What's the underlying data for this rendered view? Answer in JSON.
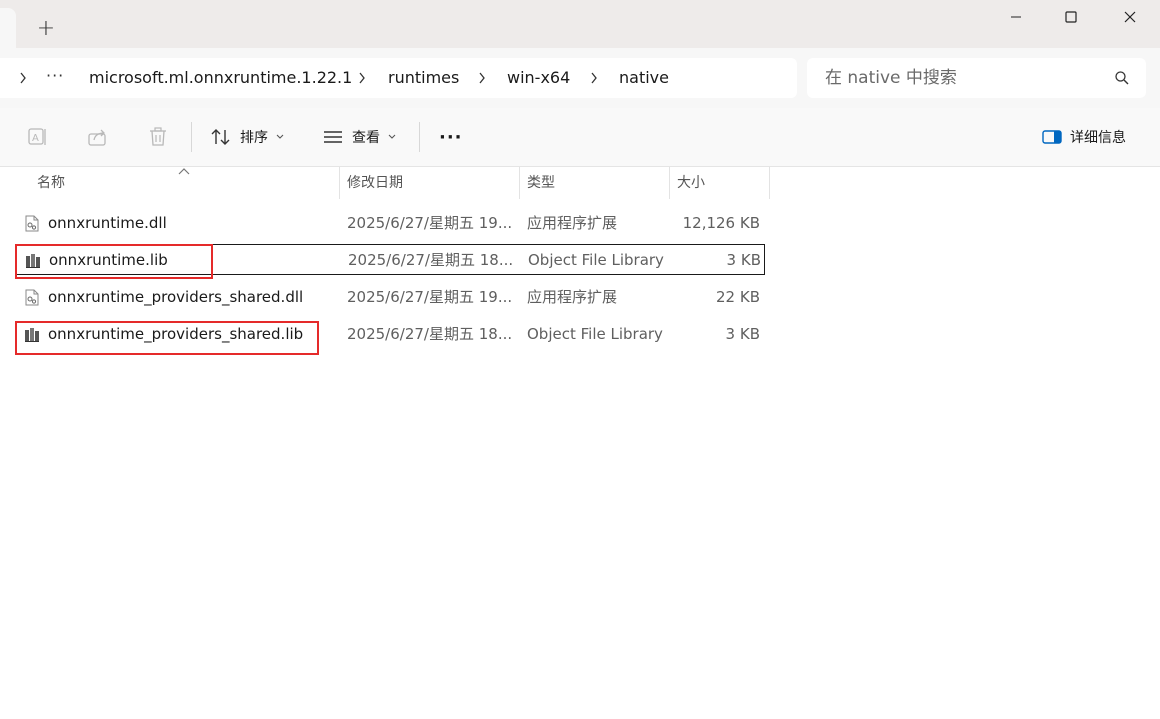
{
  "window": {
    "new_tab_label": "+",
    "controls": {
      "minimize": "minimize",
      "maximize": "maximize",
      "close": "close"
    }
  },
  "address": {
    "overflow": "···",
    "crumbs": [
      "microsoft.ml.onnxruntime.1.22.1",
      "runtimes",
      "win-x64",
      "native"
    ]
  },
  "search": {
    "placeholder": "在 native 中搜索"
  },
  "toolbar": {
    "sort_label": "排序",
    "view_label": "查看",
    "more_label": "···",
    "details_label": "详细信息"
  },
  "columns": {
    "name": "名称",
    "modified": "修改日期",
    "type": "类型",
    "size": "大小"
  },
  "files": [
    {
      "name": "onnxruntime.dll",
      "modified": "2025/6/27/星期五 19...",
      "type": "应用程序扩展",
      "size": "12,126 KB",
      "icon": "dll-file-icon"
    },
    {
      "name": "onnxruntime.lib",
      "modified": "2025/6/27/星期五 18...",
      "type": "Object File Library",
      "size": "3 KB",
      "icon": "lib-file-icon"
    },
    {
      "name": "onnxruntime_providers_shared.dll",
      "modified": "2025/6/27/星期五 19...",
      "type": "应用程序扩展",
      "size": "22 KB",
      "icon": "dll-file-icon"
    },
    {
      "name": "onnxruntime_providers_shared.lib",
      "modified": "2025/6/27/星期五 18...",
      "type": "Object File Library",
      "size": "3 KB",
      "icon": "lib-file-icon"
    }
  ],
  "colors": {
    "highlight": "#e52a2a",
    "titlebar": "#eeebea",
    "accent": "#0067c0"
  }
}
